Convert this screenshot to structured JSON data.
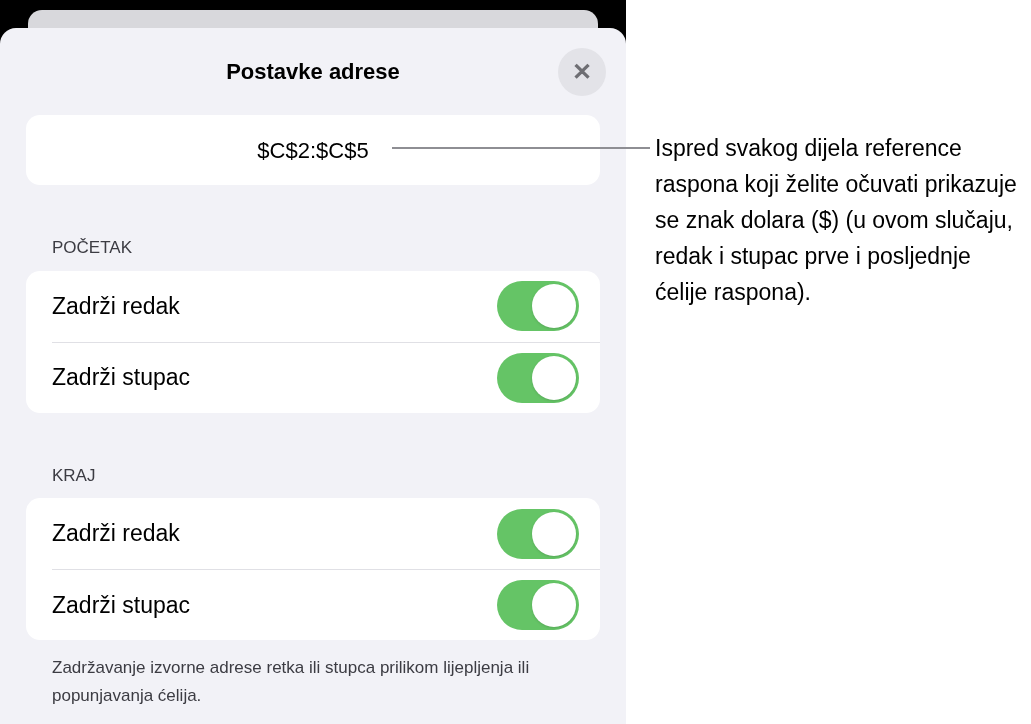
{
  "sheet": {
    "title": "Postavke adrese",
    "close_label": "✕",
    "address": "$C$2:$C$5",
    "sections": [
      {
        "header": "POČETAK",
        "rows": [
          {
            "label": "Zadrži redak",
            "on": true
          },
          {
            "label": "Zadrži stupac",
            "on": true
          }
        ]
      },
      {
        "header": "KRAJ",
        "rows": [
          {
            "label": "Zadrži redak",
            "on": true
          },
          {
            "label": "Zadrži stupac",
            "on": true
          }
        ]
      }
    ],
    "footer": "Zadržavanje izvorne adrese retka ili stupca prilikom lijepljenja ili popunjavanja ćelija."
  },
  "callout": "Ispred svakog dijela reference raspona koji želite očuvati prikazuje se znak dolara ($) (u ovom slučaju, redak i stupac prve i posljednje ćelije raspona)."
}
